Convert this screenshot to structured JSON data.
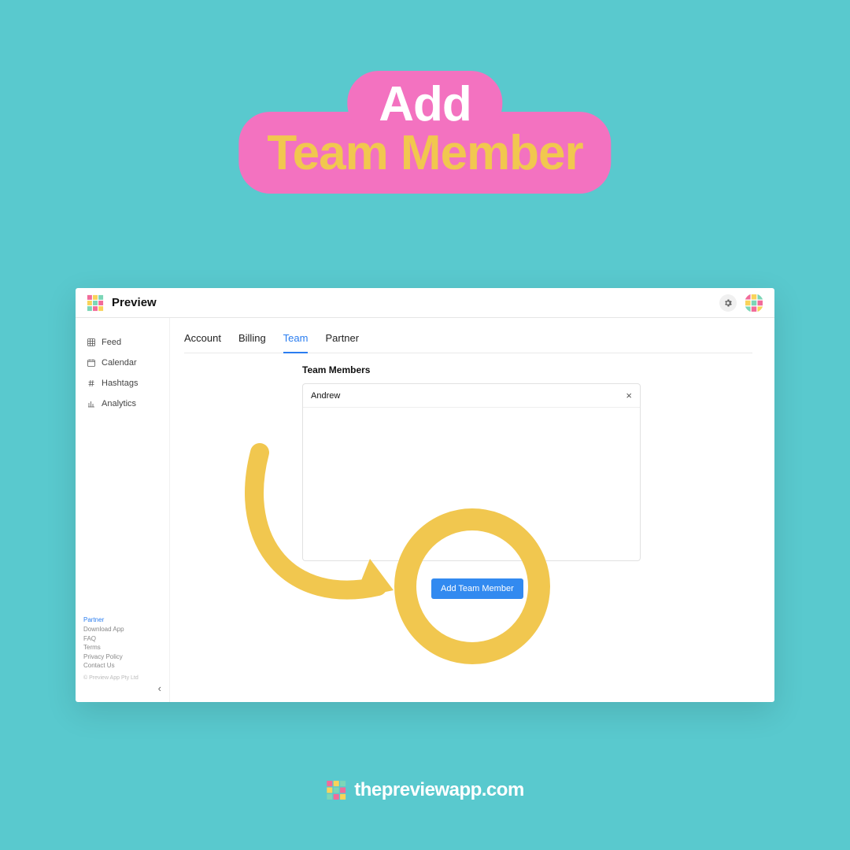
{
  "banner": {
    "line1": "Add",
    "line2": "Team Member"
  },
  "app": {
    "title": "Preview"
  },
  "sidebar": {
    "items": [
      {
        "label": "Feed"
      },
      {
        "label": "Calendar"
      },
      {
        "label": "Hashtags"
      },
      {
        "label": "Analytics"
      }
    ],
    "footer": {
      "partner": "Partner",
      "download": "Download App",
      "faq": "FAQ",
      "terms": "Terms",
      "privacy": "Privacy Policy",
      "contact": "Contact Us",
      "copyright": "© Preview App Pty Ltd"
    }
  },
  "tabs": [
    {
      "label": "Account"
    },
    {
      "label": "Billing"
    },
    {
      "label": "Team"
    },
    {
      "label": "Partner"
    }
  ],
  "active_tab_index": 2,
  "panel": {
    "title": "Team Members",
    "members": [
      {
        "name": "Andrew"
      }
    ],
    "add_button": "Add Team Member"
  },
  "domain_text": "thepreviewapp.com",
  "colors": {
    "bg": "#59c9ce",
    "pink": "#f372c0",
    "yellow": "#f1c74f",
    "blue": "#328af0"
  }
}
